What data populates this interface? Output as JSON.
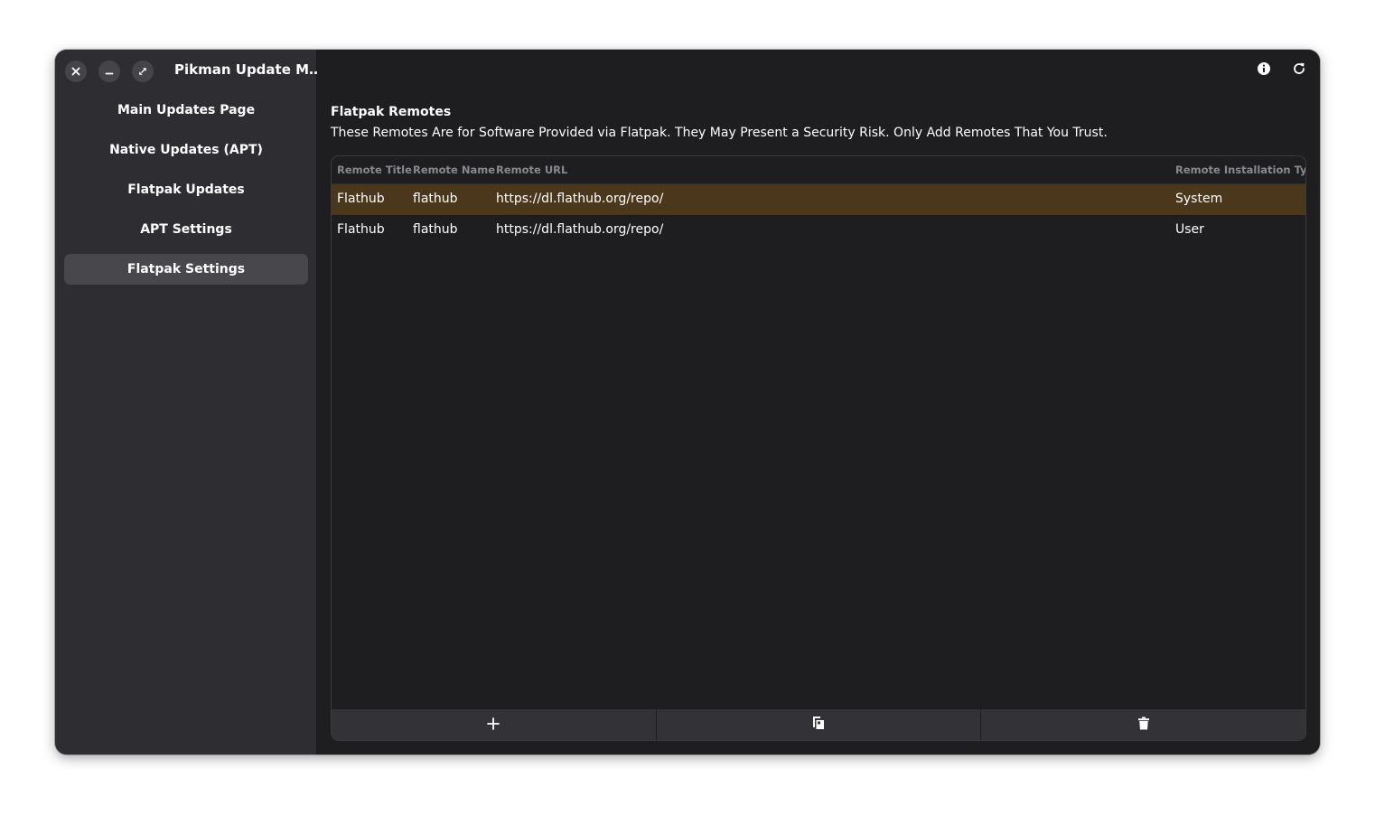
{
  "window": {
    "title": "Pikman Update M…",
    "controls": [
      "close-icon",
      "minimize-icon",
      "maximize-icon"
    ]
  },
  "sidebar": {
    "items": [
      {
        "label": "Main Updates Page",
        "active": false
      },
      {
        "label": "Native Updates (APT)",
        "active": false
      },
      {
        "label": "Flatpak Updates",
        "active": false
      },
      {
        "label": "APT Settings",
        "active": false
      },
      {
        "label": "Flatpak Settings",
        "active": true
      }
    ]
  },
  "header": {
    "icons": [
      "info-icon",
      "refresh-icon"
    ]
  },
  "main": {
    "title": "Flatpak Remotes",
    "description": "These Remotes Are for Software Provided via Flatpak. They May Present a Security Risk. Only Add Remotes That You Trust.",
    "table": {
      "columns": [
        "Remote Title",
        "Remote Name",
        "Remote URL",
        "Remote Installation Type"
      ],
      "rows": [
        {
          "title": "Flathub",
          "name": "flathub",
          "url": "https://dl.flathub.org/repo/",
          "type": "System",
          "selected": true
        },
        {
          "title": "Flathub",
          "name": "flathub",
          "url": "https://dl.flathub.org/repo/",
          "type": "User",
          "selected": false
        }
      ]
    },
    "actions": [
      "add-icon",
      "edit-icon",
      "delete-icon"
    ]
  },
  "colors": {
    "window_bg": "#1e1e21",
    "sidebar_bg": "#2e2e32",
    "active_nav": "#47474c",
    "selected_row": "#4b371b",
    "header_text": "#8a8a8e"
  }
}
